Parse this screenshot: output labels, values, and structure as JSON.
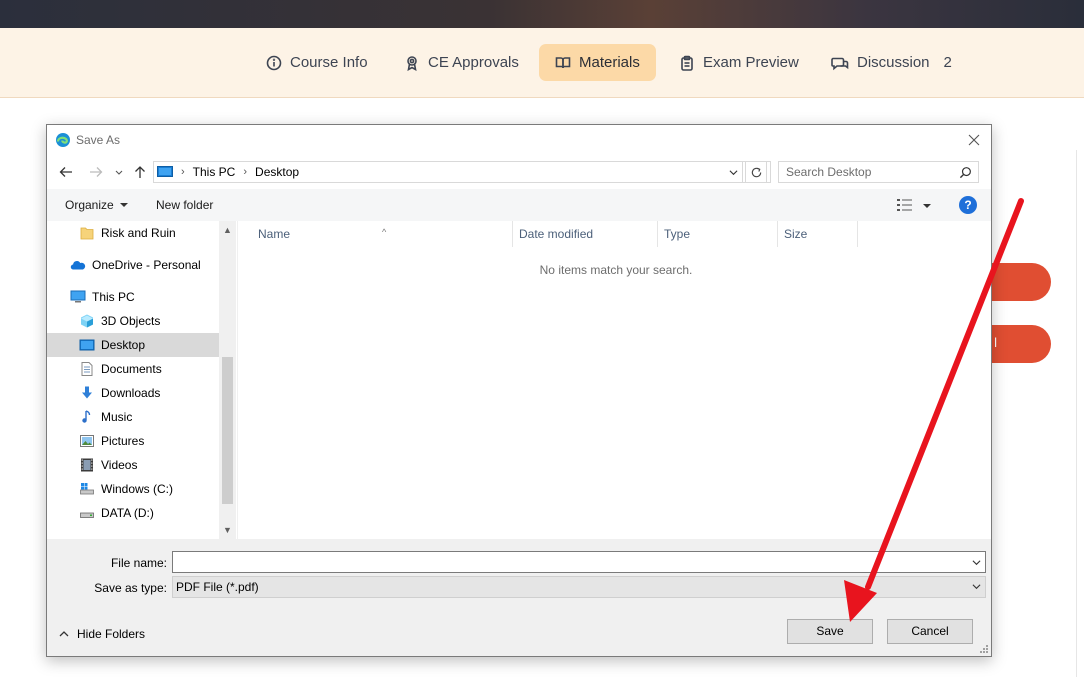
{
  "page": {
    "tabs": [
      {
        "label": "Course Info",
        "icon": "info-icon"
      },
      {
        "label": "CE Approvals",
        "icon": "award-icon"
      },
      {
        "label": "Materials",
        "icon": "book-icon",
        "active": true
      },
      {
        "label": "Exam Preview",
        "icon": "clipboard-icon"
      },
      {
        "label": "Discussion",
        "icon": "chat-icon",
        "count": "2"
      }
    ],
    "partial_button_text": "l",
    "colors": {
      "accent": "#e04e32",
      "tab_bg": "#fdf3e6",
      "tab_active": "#fcd9a7"
    }
  },
  "dialog": {
    "title": "Save As",
    "address": {
      "crumbs": [
        "This PC",
        "Desktop"
      ]
    },
    "search": {
      "placeholder": "Search Desktop"
    },
    "toolbar": {
      "organize": "Organize",
      "new_folder": "New folder",
      "help": "?"
    },
    "nav_items": [
      {
        "label": "Risk and Ruin",
        "icon": "folder-icon",
        "indent": 2
      },
      {
        "label": "OneDrive - Personal",
        "icon": "onedrive-icon",
        "indent": 1
      },
      {
        "label": "This PC",
        "icon": "computer-icon",
        "indent": 1
      },
      {
        "label": "3D Objects",
        "icon": "cube-icon",
        "indent": 2
      },
      {
        "label": "Desktop",
        "icon": "desktop-icon",
        "indent": 2,
        "selected": true
      },
      {
        "label": "Documents",
        "icon": "documents-icon",
        "indent": 2
      },
      {
        "label": "Downloads",
        "icon": "download-icon",
        "indent": 2
      },
      {
        "label": "Music",
        "icon": "music-icon",
        "indent": 2
      },
      {
        "label": "Pictures",
        "icon": "pictures-icon",
        "indent": 2
      },
      {
        "label": "Videos",
        "icon": "videos-icon",
        "indent": 2
      },
      {
        "label": "Windows (C:)",
        "icon": "drive-c-icon",
        "indent": 2
      },
      {
        "label": "DATA (D:)",
        "icon": "drive-d-icon",
        "indent": 2
      }
    ],
    "columns": [
      "Name",
      "Date modified",
      "Type",
      "Size"
    ],
    "empty_message": "No items match your search.",
    "file_name": {
      "label": "File name:",
      "value": ""
    },
    "save_as_type": {
      "label": "Save as type:",
      "value": "PDF File (*.pdf)"
    },
    "hide_folders": "Hide Folders",
    "save": "Save",
    "cancel": "Cancel"
  },
  "annotation": {
    "type": "arrow",
    "color": "#e8141e",
    "target": "save-button"
  }
}
